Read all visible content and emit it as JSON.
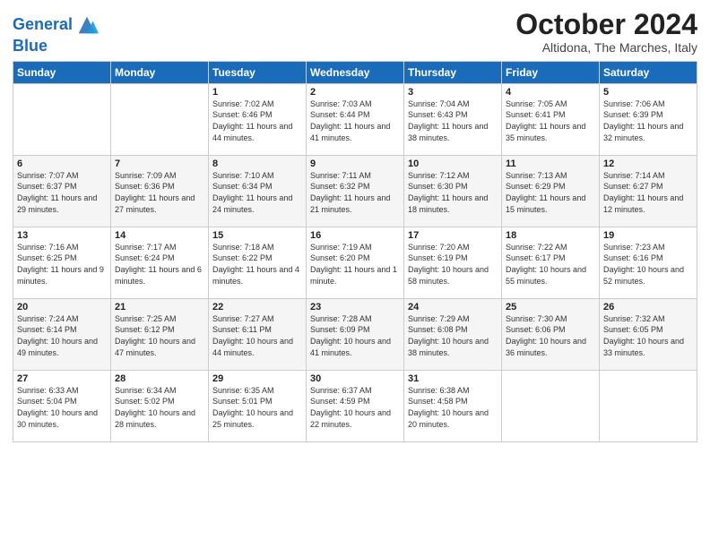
{
  "logo": {
    "line1": "General",
    "line2": "Blue"
  },
  "title": "October 2024",
  "location": "Altidona, The Marches, Italy",
  "weekdays": [
    "Sunday",
    "Monday",
    "Tuesday",
    "Wednesday",
    "Thursday",
    "Friday",
    "Saturday"
  ],
  "weeks": [
    [
      {
        "day": "",
        "info": ""
      },
      {
        "day": "",
        "info": ""
      },
      {
        "day": "1",
        "info": "Sunrise: 7:02 AM\nSunset: 6:46 PM\nDaylight: 11 hours and 44 minutes."
      },
      {
        "day": "2",
        "info": "Sunrise: 7:03 AM\nSunset: 6:44 PM\nDaylight: 11 hours and 41 minutes."
      },
      {
        "day": "3",
        "info": "Sunrise: 7:04 AM\nSunset: 6:43 PM\nDaylight: 11 hours and 38 minutes."
      },
      {
        "day": "4",
        "info": "Sunrise: 7:05 AM\nSunset: 6:41 PM\nDaylight: 11 hours and 35 minutes."
      },
      {
        "day": "5",
        "info": "Sunrise: 7:06 AM\nSunset: 6:39 PM\nDaylight: 11 hours and 32 minutes."
      }
    ],
    [
      {
        "day": "6",
        "info": "Sunrise: 7:07 AM\nSunset: 6:37 PM\nDaylight: 11 hours and 29 minutes."
      },
      {
        "day": "7",
        "info": "Sunrise: 7:09 AM\nSunset: 6:36 PM\nDaylight: 11 hours and 27 minutes."
      },
      {
        "day": "8",
        "info": "Sunrise: 7:10 AM\nSunset: 6:34 PM\nDaylight: 11 hours and 24 minutes."
      },
      {
        "day": "9",
        "info": "Sunrise: 7:11 AM\nSunset: 6:32 PM\nDaylight: 11 hours and 21 minutes."
      },
      {
        "day": "10",
        "info": "Sunrise: 7:12 AM\nSunset: 6:30 PM\nDaylight: 11 hours and 18 minutes."
      },
      {
        "day": "11",
        "info": "Sunrise: 7:13 AM\nSunset: 6:29 PM\nDaylight: 11 hours and 15 minutes."
      },
      {
        "day": "12",
        "info": "Sunrise: 7:14 AM\nSunset: 6:27 PM\nDaylight: 11 hours and 12 minutes."
      }
    ],
    [
      {
        "day": "13",
        "info": "Sunrise: 7:16 AM\nSunset: 6:25 PM\nDaylight: 11 hours and 9 minutes."
      },
      {
        "day": "14",
        "info": "Sunrise: 7:17 AM\nSunset: 6:24 PM\nDaylight: 11 hours and 6 minutes."
      },
      {
        "day": "15",
        "info": "Sunrise: 7:18 AM\nSunset: 6:22 PM\nDaylight: 11 hours and 4 minutes."
      },
      {
        "day": "16",
        "info": "Sunrise: 7:19 AM\nSunset: 6:20 PM\nDaylight: 11 hours and 1 minute."
      },
      {
        "day": "17",
        "info": "Sunrise: 7:20 AM\nSunset: 6:19 PM\nDaylight: 10 hours and 58 minutes."
      },
      {
        "day": "18",
        "info": "Sunrise: 7:22 AM\nSunset: 6:17 PM\nDaylight: 10 hours and 55 minutes."
      },
      {
        "day": "19",
        "info": "Sunrise: 7:23 AM\nSunset: 6:16 PM\nDaylight: 10 hours and 52 minutes."
      }
    ],
    [
      {
        "day": "20",
        "info": "Sunrise: 7:24 AM\nSunset: 6:14 PM\nDaylight: 10 hours and 49 minutes."
      },
      {
        "day": "21",
        "info": "Sunrise: 7:25 AM\nSunset: 6:12 PM\nDaylight: 10 hours and 47 minutes."
      },
      {
        "day": "22",
        "info": "Sunrise: 7:27 AM\nSunset: 6:11 PM\nDaylight: 10 hours and 44 minutes."
      },
      {
        "day": "23",
        "info": "Sunrise: 7:28 AM\nSunset: 6:09 PM\nDaylight: 10 hours and 41 minutes."
      },
      {
        "day": "24",
        "info": "Sunrise: 7:29 AM\nSunset: 6:08 PM\nDaylight: 10 hours and 38 minutes."
      },
      {
        "day": "25",
        "info": "Sunrise: 7:30 AM\nSunset: 6:06 PM\nDaylight: 10 hours and 36 minutes."
      },
      {
        "day": "26",
        "info": "Sunrise: 7:32 AM\nSunset: 6:05 PM\nDaylight: 10 hours and 33 minutes."
      }
    ],
    [
      {
        "day": "27",
        "info": "Sunrise: 6:33 AM\nSunset: 5:04 PM\nDaylight: 10 hours and 30 minutes."
      },
      {
        "day": "28",
        "info": "Sunrise: 6:34 AM\nSunset: 5:02 PM\nDaylight: 10 hours and 28 minutes."
      },
      {
        "day": "29",
        "info": "Sunrise: 6:35 AM\nSunset: 5:01 PM\nDaylight: 10 hours and 25 minutes."
      },
      {
        "day": "30",
        "info": "Sunrise: 6:37 AM\nSunset: 4:59 PM\nDaylight: 10 hours and 22 minutes."
      },
      {
        "day": "31",
        "info": "Sunrise: 6:38 AM\nSunset: 4:58 PM\nDaylight: 10 hours and 20 minutes."
      },
      {
        "day": "",
        "info": ""
      },
      {
        "day": "",
        "info": ""
      }
    ]
  ]
}
